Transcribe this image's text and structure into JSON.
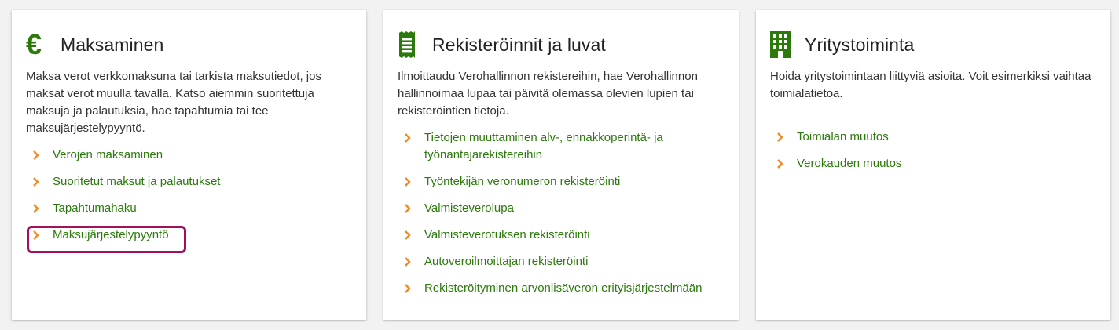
{
  "colors": {
    "accent": "#2b7a0b",
    "chevron": "#f08a24",
    "highlight": "#a5105b"
  },
  "cards": [
    {
      "icon": "euro-icon",
      "title": "Maksaminen",
      "description": "Maksa verot verkkomaksuna tai tarkista maksutiedot, jos maksat verot muulla tavalla. Katso aiemmin suoritettuja maksuja ja palautuksia, hae tapahtumia tai tee maksujärjestelypyyntö.",
      "links": [
        "Verojen maksaminen",
        "Suoritetut maksut ja palautukset",
        "Tapahtumahaku",
        "Maksujärjestelypyyntö"
      ]
    },
    {
      "icon": "receipt-icon",
      "title": "Rekisteröinnit ja luvat",
      "description": "Ilmoittaudu Verohallinnon rekistereihin, hae Verohallinnon hallinnoimaa lupaa tai päivitä olemassa olevien lupien tai rekisteröintien tietoja.",
      "links": [
        "Tietojen muuttaminen alv-, ennakkoperintä- ja työnantajarekistereihin",
        "Työntekijän veronumeron rekisteröinti",
        "Valmisteverolupa",
        "Valmisteverotuksen rekisteröinti",
        "Autoveroilmoittajan rekisteröinti",
        "Rekisteröityminen arvonlisäveron erityisjärjestelmään"
      ]
    },
    {
      "icon": "building-icon",
      "title": "Yritystoiminta",
      "description": "Hoida yritystoimintaan liittyviä asioita. Voit esimerkiksi vaihtaa toimialatietoa.",
      "links": [
        "Toimialan muutos",
        "Verokauden muutos"
      ]
    }
  ]
}
